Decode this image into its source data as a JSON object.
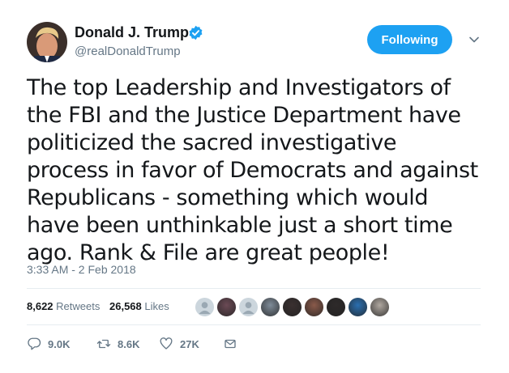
{
  "author": {
    "name": "Donald J. Trump",
    "handle": "@realDonaldTrump",
    "verified": true
  },
  "follow_button": {
    "label": "Following",
    "color": "#1da1f2"
  },
  "tweet": {
    "text": "The top Leadership and Investigators of the FBI and the Justice Department have politicized the sacred investigative process in favor of Democrats and against Republicans - something which would have been unthinkable just a short time ago. Rank & File are great people!",
    "timestamp": "3:33 AM - 2 Feb 2018"
  },
  "stats": {
    "retweets_count": "8,622",
    "retweets_label": "Retweets",
    "likes_count": "26,568",
    "likes_label": "Likes"
  },
  "likers": [
    {
      "kind": "default",
      "color": "#9aa8b3"
    },
    {
      "kind": "photo",
      "color": "#6b4a55"
    },
    {
      "kind": "default",
      "color": "#9aa8b3"
    },
    {
      "kind": "photo",
      "color": "#7f8c99"
    },
    {
      "kind": "photo",
      "color": "#3a3030"
    },
    {
      "kind": "photo",
      "color": "#8a5a4a"
    },
    {
      "kind": "photo",
      "color": "#2e2a2a"
    },
    {
      "kind": "photo",
      "color": "#2a6fb0"
    },
    {
      "kind": "photo",
      "color": "#b0a8a0"
    }
  ],
  "actions": {
    "replies": "9.0K",
    "retweets": "8.6K",
    "likes": "27K"
  },
  "icons": {
    "reply": "reply-icon",
    "retweet": "retweet-icon",
    "like": "heart-icon",
    "dm": "envelope-icon",
    "verified": "verified-badge-icon",
    "caret": "chevron-down-icon"
  }
}
